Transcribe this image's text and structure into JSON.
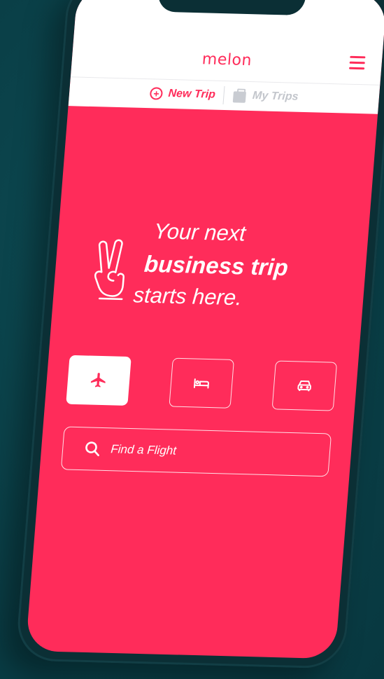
{
  "app": {
    "brand": "melon"
  },
  "subnav": {
    "new_trip_label": "New Trip",
    "my_trips_label": "My Trips"
  },
  "hero": {
    "line1": "Your next",
    "line2": "business trip",
    "line3": "starts here."
  },
  "modes": [
    {
      "icon": "airplane-icon",
      "active": true
    },
    {
      "icon": "bed-icon",
      "active": false
    },
    {
      "icon": "car-icon",
      "active": false
    }
  ],
  "search": {
    "placeholder": "Find a Flight"
  },
  "colors": {
    "brand": "#ff2c5a",
    "background": "#0a3f47",
    "header": "#ffffff",
    "inactive_tab": "#c3c6cc"
  }
}
